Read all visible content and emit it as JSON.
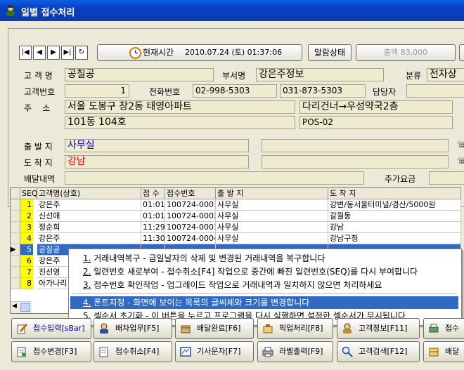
{
  "window": {
    "title": "일별 접수처리"
  },
  "toolbar": {
    "nav": [
      "|◀",
      "◀",
      "▶",
      "▶|",
      "↻"
    ],
    "clock_label": "현재시간",
    "clock_value": "2010.07.24 (토) 01:37:06",
    "alarm_label": "알람상태",
    "total_label": "총액 83,000"
  },
  "form": {
    "customer_label": "고 객 명",
    "customer": "공칠공",
    "dept_label": "부서명",
    "dept": "강은주정보",
    "category_label": "분류",
    "category": "전자상",
    "custno_label": "고객번호",
    "custno": "1",
    "phone_label": "전화번호",
    "phone1": "02-998-5303",
    "phone2": "031-873-5303",
    "manager_label": "담당자",
    "addr_label": "주    소",
    "addr1": "서울 도봉구 창2동 태영아파트",
    "addr2": "다리건너→우성약국2층",
    "addr3": "101동 104호",
    "addr4": "POS-02",
    "origin_label": "출 발 지",
    "origin": "사무실",
    "dest_label": "도 착 지",
    "dest": "강남",
    "delivery_label": "배달내역",
    "extra_label": "추가요금"
  },
  "grid": {
    "columns": [
      "SEQ",
      "고객명(상호)",
      "접 수",
      "접수번호",
      "출 발 지",
      "도 착 지"
    ],
    "rows": [
      {
        "seq": "1",
        "name": "강은주",
        "time": "01:01",
        "no": "100724-0001",
        "from": "사무실",
        "to": "강변/동서울터미널/경산/5000원"
      },
      {
        "seq": "2",
        "name": "신선애",
        "time": "01:01",
        "no": "100724-0002",
        "from": "사무실",
        "to": "갈월동"
      },
      {
        "seq": "3",
        "name": "정순희",
        "time": "11:29",
        "no": "100724-0003",
        "from": "사무실",
        "to": "강남"
      },
      {
        "seq": "4",
        "name": "강은주",
        "time": "11:30",
        "no": "100724-0004",
        "from": "사무실",
        "to": "강남구청"
      },
      {
        "seq": "5",
        "name": "공칠공",
        "time": "",
        "no": "",
        "from": "",
        "to": ""
      },
      {
        "seq": "6",
        "name": "강은주",
        "time": "",
        "no": "",
        "from": "",
        "to": ""
      },
      {
        "seq": "7",
        "name": "진선영",
        "time": "",
        "no": "",
        "from": "",
        "to": ""
      },
      {
        "seq": "8",
        "name": "아가나리",
        "time": "",
        "no": "",
        "from": "",
        "to": ""
      }
    ]
  },
  "context_menu": {
    "items": [
      {
        "num": "1.",
        "text": " 거래내역복구 - 금일날자의 삭제 및 변경된 거래내역을 복구합니다"
      },
      {
        "num": "2.",
        "text": " 일련번호 새로부여 - 접수취소[F4] 작업으로 중간에 빠진 일련번호(SEQ)를 다시 부여합니다"
      },
      {
        "num": "3.",
        "text": " 접수번호 확인작업 - 업그레이드 작업으로 거래내역과 일치하지 않으면 처리하세요"
      },
      {
        "num": "4.",
        "text": " 폰트지정 - 화면에 보이는 목록의 글씨체와 크기를 변경합니다"
      },
      {
        "num": "5.",
        "text": " 셀순서 초기화 - 이 버튼을 누르고 프로그램을 다시 실행하면 설정한 셀순서가 무시됩니다"
      }
    ]
  },
  "buttons_row1": [
    "접수입력[sBar]",
    "배차업무[F5]",
    "배달완료[F6]",
    "픽업처리[F8]",
    "고객정보[F11]",
    "접수"
  ],
  "buttons_row2": [
    "접수변경[F3]",
    "접수취소[F4]",
    "기사문자[F7]",
    "라벨출력[F9]",
    "고객검색[F12]",
    "배달"
  ],
  "colors": {
    "title": "#0A4FD0",
    "field": "#EFEBCF",
    "highlight": "#316AC5",
    "seq": "#FFFF00"
  }
}
